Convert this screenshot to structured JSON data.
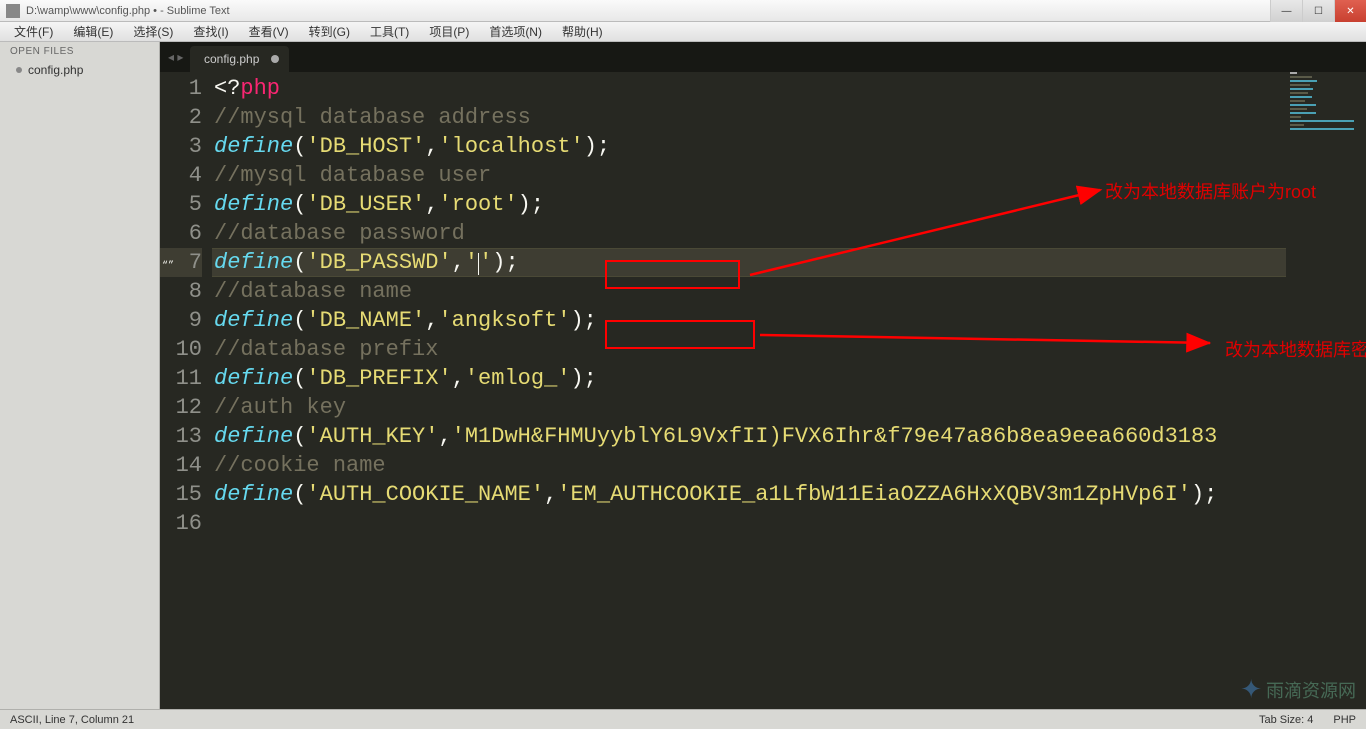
{
  "window": {
    "title": "D:\\wamp\\www\\config.php • - Sublime Text",
    "min": "—",
    "max": "☐",
    "close": "✕"
  },
  "menu": [
    "文件(F)",
    "编辑(E)",
    "选择(S)",
    "查找(I)",
    "查看(V)",
    "转到(G)",
    "工具(T)",
    "项目(P)",
    "首选项(N)",
    "帮助(H)"
  ],
  "sidebar": {
    "header": "OPEN FILES",
    "items": [
      "config.php"
    ]
  },
  "tabs": {
    "arrow": "◂ ▸",
    "items": [
      {
        "label": "config.php",
        "modified": true
      }
    ]
  },
  "code": {
    "lines": [
      {
        "n": 1,
        "segs": [
          {
            "t": "<?",
            "c": "pu"
          },
          {
            "t": "php",
            "c": "kw"
          }
        ]
      },
      {
        "n": 2,
        "segs": [
          {
            "t": "//mysql database address",
            "c": "co"
          }
        ]
      },
      {
        "n": 3,
        "segs": [
          {
            "t": "define",
            "c": "fn"
          },
          {
            "t": "(",
            "c": "pu"
          },
          {
            "t": "'DB_HOST'",
            "c": "st"
          },
          {
            "t": ",",
            "c": "pu"
          },
          {
            "t": "'localhost'",
            "c": "st"
          },
          {
            "t": ");",
            "c": "pu"
          }
        ]
      },
      {
        "n": 4,
        "segs": [
          {
            "t": "//mysql database user",
            "c": "co"
          }
        ]
      },
      {
        "n": 5,
        "segs": [
          {
            "t": "define",
            "c": "fn"
          },
          {
            "t": "(",
            "c": "pu"
          },
          {
            "t": "'DB_USER'",
            "c": "st"
          },
          {
            "t": ",",
            "c": "pu"
          },
          {
            "t": "'root'",
            "c": "st"
          },
          {
            "t": ");",
            "c": "pu"
          }
        ]
      },
      {
        "n": 6,
        "segs": [
          {
            "t": "//database password",
            "c": "co"
          }
        ]
      },
      {
        "n": 7,
        "current": true,
        "segs": [
          {
            "t": "define",
            "c": "fn"
          },
          {
            "t": "(",
            "c": "pu"
          },
          {
            "t": "'DB_PASSWD'",
            "c": "st"
          },
          {
            "t": ",",
            "c": "pu"
          },
          {
            "t": "'",
            "c": "st"
          },
          {
            "cursor": true
          },
          {
            "t": "'",
            "c": "st"
          },
          {
            "t": ");",
            "c": "pu"
          }
        ]
      },
      {
        "n": 8,
        "segs": [
          {
            "t": "//database name",
            "c": "co"
          }
        ]
      },
      {
        "n": 9,
        "segs": [
          {
            "t": "define",
            "c": "fn"
          },
          {
            "t": "(",
            "c": "pu"
          },
          {
            "t": "'DB_NAME'",
            "c": "st"
          },
          {
            "t": ",",
            "c": "pu"
          },
          {
            "t": "'angksoft'",
            "c": "st"
          },
          {
            "t": ");",
            "c": "pu"
          }
        ]
      },
      {
        "n": 10,
        "segs": [
          {
            "t": "//database prefix",
            "c": "co"
          }
        ]
      },
      {
        "n": 11,
        "segs": [
          {
            "t": "define",
            "c": "fn"
          },
          {
            "t": "(",
            "c": "pu"
          },
          {
            "t": "'DB_PREFIX'",
            "c": "st"
          },
          {
            "t": ",",
            "c": "pu"
          },
          {
            "t": "'emlog_'",
            "c": "st"
          },
          {
            "t": ");",
            "c": "pu"
          }
        ]
      },
      {
        "n": 12,
        "segs": [
          {
            "t": "//auth key",
            "c": "co"
          }
        ]
      },
      {
        "n": 13,
        "segs": [
          {
            "t": "define",
            "c": "fn"
          },
          {
            "t": "(",
            "c": "pu"
          },
          {
            "t": "'AUTH_KEY'",
            "c": "st"
          },
          {
            "t": ",",
            "c": "pu"
          },
          {
            "t": "'M1DwH&FHMUyyblY6L9VxfII)FVX6Ihr&f79e47a86b8ea9eea660d3183",
            "c": "st"
          }
        ]
      },
      {
        "n": 14,
        "segs": [
          {
            "t": "//cookie name",
            "c": "co"
          }
        ]
      },
      {
        "n": 15,
        "segs": [
          {
            "t": "define",
            "c": "fn"
          },
          {
            "t": "(",
            "c": "pu"
          },
          {
            "t": "'AUTH_COOKIE_NAME'",
            "c": "st"
          },
          {
            "t": ",",
            "c": "pu"
          },
          {
            "t": "'EM_AUTHCOOKIE_a1LfbW11EiaOZZA6HxXQBV3m1ZpHVp6I'",
            "c": "st"
          },
          {
            "t": ");",
            "c": "pu"
          }
        ]
      },
      {
        "n": 16,
        "segs": []
      }
    ],
    "gutter_mark": "“”"
  },
  "annotations": {
    "text1": "改为本地数据库账户为root",
    "text2": "改为本地数据库密码为空"
  },
  "status": {
    "left": "ASCII, Line 7, Column 21",
    "tab": "Tab Size: 4",
    "lang": "PHP"
  },
  "watermark": "雨滴资源网"
}
